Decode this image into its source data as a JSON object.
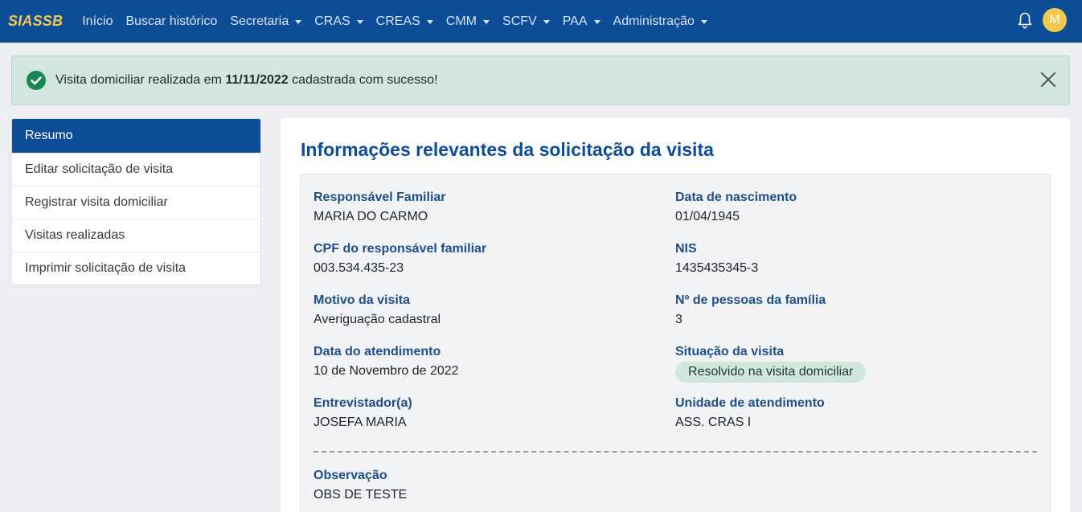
{
  "nav": {
    "brand": "SIASSB",
    "items": [
      {
        "label": "Início",
        "dropdown": false
      },
      {
        "label": "Buscar histórico",
        "dropdown": false
      },
      {
        "label": "Secretaria",
        "dropdown": true
      },
      {
        "label": "CRAS",
        "dropdown": true
      },
      {
        "label": "CREAS",
        "dropdown": true
      },
      {
        "label": "CMM",
        "dropdown": true
      },
      {
        "label": "SCFV",
        "dropdown": true
      },
      {
        "label": "PAA",
        "dropdown": true
      },
      {
        "label": "Administração",
        "dropdown": true
      }
    ],
    "bell_icon": "bell-icon",
    "avatar_initial": "M"
  },
  "alert": {
    "prefix": "Visita domiciliar realizada em ",
    "date": "11/11/2022",
    "suffix": " cadastrada com sucesso!",
    "icon": "check-circle-icon",
    "close_icon": "close-icon"
  },
  "sidebar": {
    "items": [
      {
        "label": "Resumo",
        "active": true
      },
      {
        "label": "Editar solicitação de visita",
        "active": false
      },
      {
        "label": "Registrar visita domiciliar",
        "active": false
      },
      {
        "label": "Visitas realizadas",
        "active": false
      },
      {
        "label": "Imprimir solicitação de visita",
        "active": false
      }
    ]
  },
  "main": {
    "title": "Informações relevantes da solicitação da visita",
    "fields": {
      "responsavel": {
        "label": "Responsável Familiar",
        "value": "MARIA DO CARMO"
      },
      "nascimento": {
        "label": "Data de nascimento",
        "value": "01/04/1945"
      },
      "cpf": {
        "label": "CPF do responsável familiar",
        "value": "003.534.435-23"
      },
      "nis": {
        "label": "NIS",
        "value": "1435435345-3"
      },
      "motivo": {
        "label": "Motivo da visita",
        "value": "Averiguação cadastral"
      },
      "pessoas": {
        "label": "Nº de pessoas da família",
        "value": "3"
      },
      "data_atendimento": {
        "label": "Data do atendimento",
        "value": "10 de Novembro de 2022"
      },
      "situacao": {
        "label": "Situação da visita",
        "value": "Resolvido na visita domiciliar"
      },
      "entrevistador": {
        "label": "Entrevistador(a)",
        "value": "JOSEFA MARIA"
      },
      "unidade": {
        "label": "Unidade de atendimento",
        "value": "ASS. CRAS I"
      },
      "observacao": {
        "label": "Observação",
        "value": "OBS DE TESTE"
      }
    }
  },
  "colors": {
    "navbar": "#0d4c97",
    "brand": "#f2c94c",
    "success_bg": "#d1e7dd",
    "success_icon": "#198754"
  }
}
